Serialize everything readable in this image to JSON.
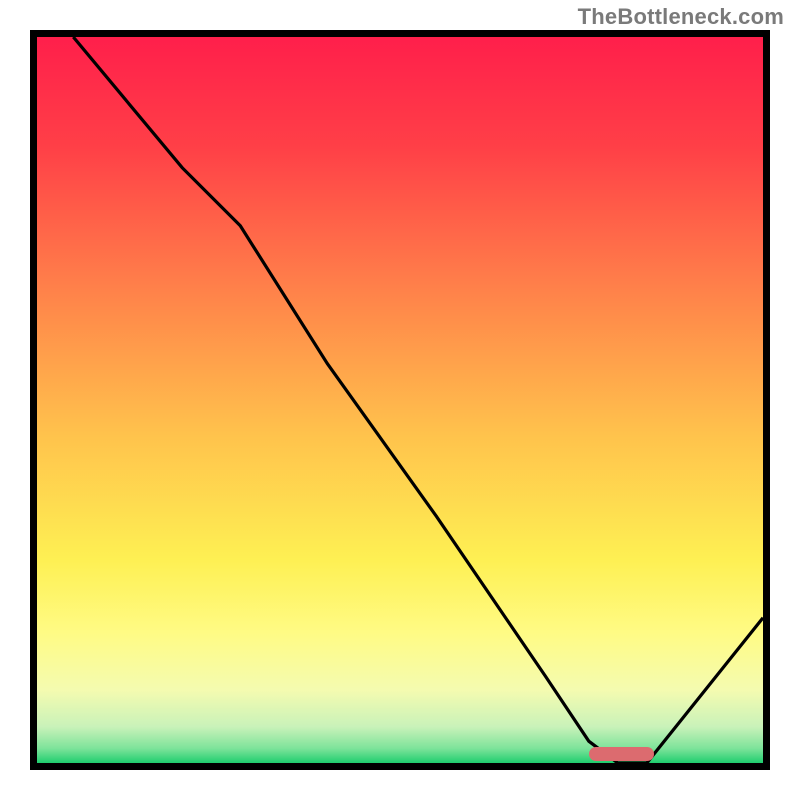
{
  "watermark": "TheBottleneck.com",
  "chart_data": {
    "type": "line",
    "title": "",
    "xlabel": "",
    "ylabel": "",
    "x_range": [
      0,
      100
    ],
    "y_range": [
      0,
      100
    ],
    "series": [
      {
        "name": "curve",
        "x": [
          5,
          20,
          28,
          40,
          55,
          70,
          76,
          80,
          84,
          100
        ],
        "y": [
          100,
          82,
          74,
          55,
          34,
          12,
          3,
          0,
          0,
          20
        ]
      }
    ],
    "gradient_stops": [
      {
        "offset": 0,
        "color": "#ff1f4b"
      },
      {
        "offset": 15,
        "color": "#ff3f47"
      },
      {
        "offset": 35,
        "color": "#ff824a"
      },
      {
        "offset": 55,
        "color": "#ffc34c"
      },
      {
        "offset": 72,
        "color": "#fef053"
      },
      {
        "offset": 82,
        "color": "#fffb84"
      },
      {
        "offset": 90,
        "color": "#f4fbb0"
      },
      {
        "offset": 95,
        "color": "#c9f2b9"
      },
      {
        "offset": 98,
        "color": "#7de39a"
      },
      {
        "offset": 100,
        "color": "#1fce6e"
      }
    ],
    "marker": {
      "x_start": 76,
      "x_end": 85,
      "y": 0,
      "color": "#dc6b6f"
    }
  }
}
